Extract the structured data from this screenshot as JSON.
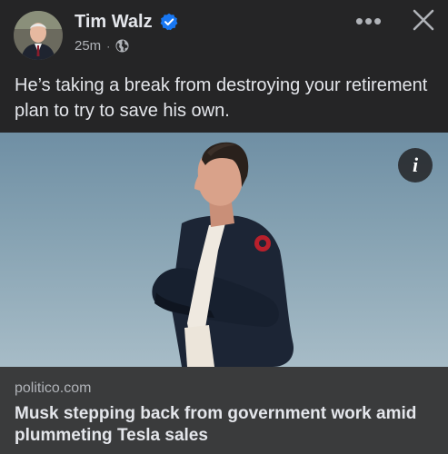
{
  "post": {
    "author": "Tim Walz",
    "time": "25m",
    "separator": "·",
    "caption": "He’s taking a break from destroying your retirement plan to try to save his own.",
    "verified": true
  },
  "icons": {
    "avatar": "avatar-portrait",
    "verified": "verified-badge-icon",
    "privacy": "globe-icon",
    "more": "more-horizontal-icon",
    "close": "close-icon",
    "info": "info-icon"
  },
  "toolbar": {
    "more_glyph": "•••",
    "info_glyph": "i"
  },
  "link": {
    "domain": "politico.com",
    "headline": "Musk stepping back from government work amid plummeting Tesla sales"
  },
  "colors": {
    "background": "#252526",
    "link_box": "#3a3b3c",
    "verified": "#1877f2",
    "text": "#e4e6eb",
    "secondary_text": "#b0b3b8"
  }
}
